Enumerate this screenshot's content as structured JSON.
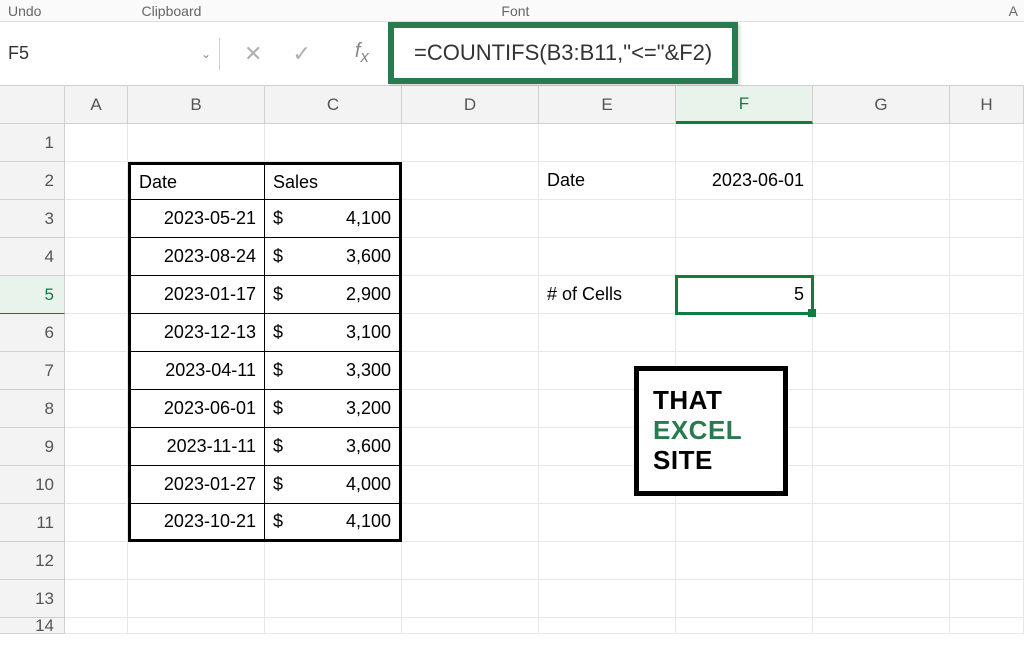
{
  "ribbon": {
    "undo": "Undo",
    "clipboard": "Clipboard",
    "font": "Font",
    "a": "A"
  },
  "name_box": "F5",
  "formula": "=COUNTIFS(B3:B11,\"<=\"&F2)",
  "columns": [
    "A",
    "B",
    "C",
    "D",
    "E",
    "F",
    "G",
    "H"
  ],
  "rows": [
    "1",
    "2",
    "3",
    "4",
    "5",
    "6",
    "7",
    "8",
    "9",
    "10",
    "11",
    "12",
    "13",
    "14"
  ],
  "active_col": "F",
  "active_row": "5",
  "headers": {
    "date": "Date",
    "sales": "Sales"
  },
  "table": [
    {
      "date": "2023-05-21",
      "sales": "4,100"
    },
    {
      "date": "2023-08-24",
      "sales": "3,600"
    },
    {
      "date": "2023-01-17",
      "sales": "2,900"
    },
    {
      "date": "2023-12-13",
      "sales": "3,100"
    },
    {
      "date": "2023-04-11",
      "sales": "3,300"
    },
    {
      "date": "2023-06-01",
      "sales": "3,200"
    },
    {
      "date": "2023-11-11",
      "sales": "3,600"
    },
    {
      "date": "2023-01-27",
      "sales": "4,000"
    },
    {
      "date": "2023-10-21",
      "sales": "4,100"
    }
  ],
  "labels": {
    "date": "Date",
    "date_value": "2023-06-01",
    "cells": "# of Cells",
    "cells_value": "5",
    "dollar": "$"
  },
  "logo": {
    "line1": "THAT",
    "line2": "EXCEL",
    "line3": "SITE"
  }
}
